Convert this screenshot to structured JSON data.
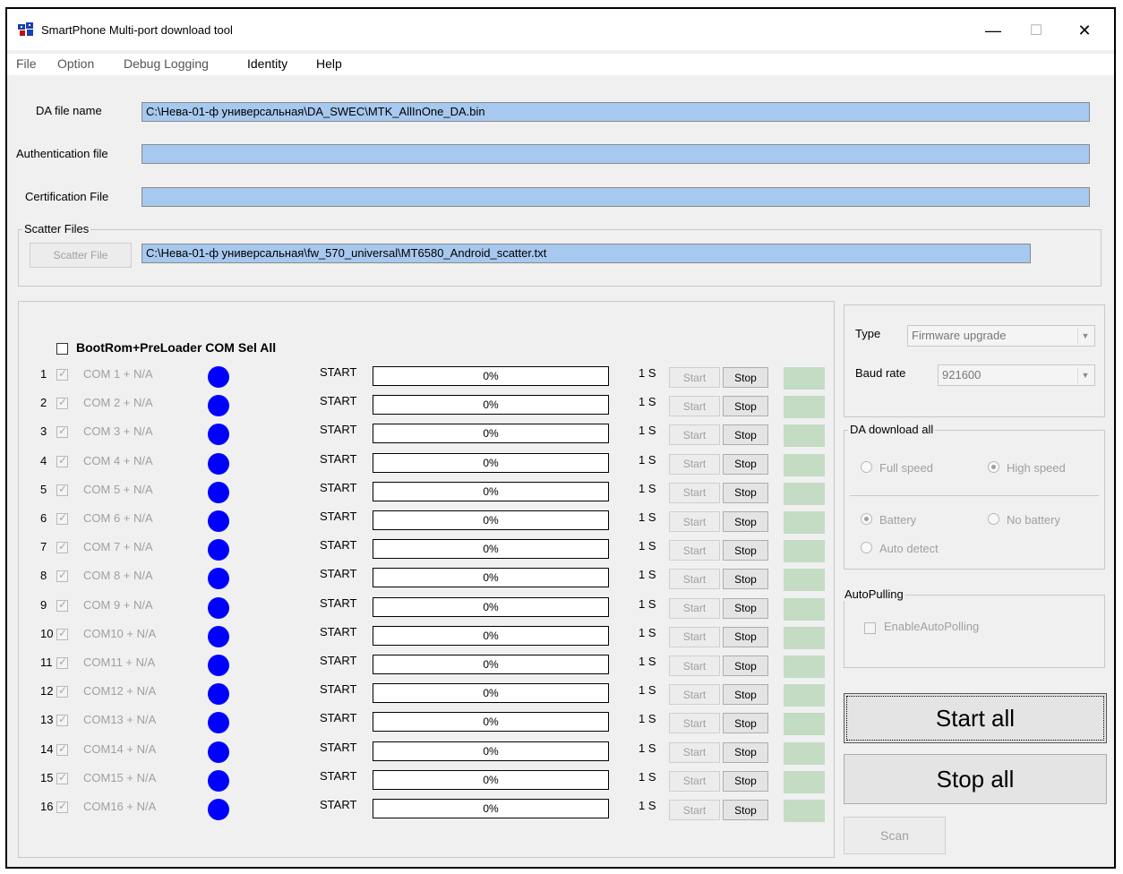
{
  "window": {
    "title": "SmartPhone Multi-port download tool",
    "minimize": "—",
    "maximize": "☐",
    "close": "✕"
  },
  "menu": [
    "File",
    "Option",
    "Debug Logging",
    "Identity",
    "Help"
  ],
  "files": {
    "da_label": "DA file name",
    "da_value": "C:\\Нева-01-ф универсальная\\DA_SWEC\\MTK_AllInOne_DA.bin",
    "auth_label": "Authentication file",
    "auth_value": "",
    "cert_label": "Certification File",
    "cert_value": ""
  },
  "scatter": {
    "group_title": "Scatter Files",
    "button": "Scatter File",
    "value": "C:\\Нева-01-ф универсальная\\fw_570_universal\\MT6580_Android_scatter.txt"
  },
  "ports": {
    "sel_all_label": "BootRom+PreLoader COM Sel All",
    "rows": [
      {
        "num": "1",
        "port": "COM 1 + N/A",
        "status": "START",
        "progress": "0%",
        "time": "1 S",
        "start": "Start",
        "stop": "Stop"
      },
      {
        "num": "2",
        "port": "COM 2 + N/A",
        "status": "START",
        "progress": "0%",
        "time": "1 S",
        "start": "Start",
        "stop": "Stop"
      },
      {
        "num": "3",
        "port": "COM 3 + N/A",
        "status": "START",
        "progress": "0%",
        "time": "1 S",
        "start": "Start",
        "stop": "Stop"
      },
      {
        "num": "4",
        "port": "COM 4 + N/A",
        "status": "START",
        "progress": "0%",
        "time": "1 S",
        "start": "Start",
        "stop": "Stop"
      },
      {
        "num": "5",
        "port": "COM 5 + N/A",
        "status": "START",
        "progress": "0%",
        "time": "1 S",
        "start": "Start",
        "stop": "Stop"
      },
      {
        "num": "6",
        "port": "COM 6 + N/A",
        "status": "START",
        "progress": "0%",
        "time": "1 S",
        "start": "Start",
        "stop": "Stop"
      },
      {
        "num": "7",
        "port": "COM 7 + N/A",
        "status": "START",
        "progress": "0%",
        "time": "1 S",
        "start": "Start",
        "stop": "Stop"
      },
      {
        "num": "8",
        "port": "COM 8 + N/A",
        "status": "START",
        "progress": "0%",
        "time": "1 S",
        "start": "Start",
        "stop": "Stop"
      },
      {
        "num": "9",
        "port": "COM 9 + N/A",
        "status": "START",
        "progress": "0%",
        "time": "1 S",
        "start": "Start",
        "stop": "Stop"
      },
      {
        "num": "10",
        "port": "COM10 + N/A",
        "status": "START",
        "progress": "0%",
        "time": "1 S",
        "start": "Start",
        "stop": "Stop"
      },
      {
        "num": "11",
        "port": "COM11 + N/A",
        "status": "START",
        "progress": "0%",
        "time": "1 S",
        "start": "Start",
        "stop": "Stop"
      },
      {
        "num": "12",
        "port": "COM12 + N/A",
        "status": "START",
        "progress": "0%",
        "time": "1 S",
        "start": "Start",
        "stop": "Stop"
      },
      {
        "num": "13",
        "port": "COM13 + N/A",
        "status": "START",
        "progress": "0%",
        "time": "1 S",
        "start": "Start",
        "stop": "Stop"
      },
      {
        "num": "14",
        "port": "COM14 + N/A",
        "status": "START",
        "progress": "0%",
        "time": "1 S",
        "start": "Start",
        "stop": "Stop"
      },
      {
        "num": "15",
        "port": "COM15 + N/A",
        "status": "START",
        "progress": "0%",
        "time": "1 S",
        "start": "Start",
        "stop": "Stop"
      },
      {
        "num": "16",
        "port": "COM16 + N/A",
        "status": "START",
        "progress": "0%",
        "time": "1 S",
        "start": "Start",
        "stop": "Stop"
      }
    ]
  },
  "settings": {
    "type_label": "Type",
    "type_value": "Firmware upgrade",
    "baud_label": "Baud rate",
    "baud_value": "921600"
  },
  "da_download": {
    "group_title": "DA download all",
    "full_speed": "Full speed",
    "high_speed": "High speed",
    "battery": "Battery",
    "no_battery": "No battery",
    "auto_detect": "Auto detect"
  },
  "autopolling": {
    "group_title": "AutoPulling",
    "enable_label": "EnableAutoPolling"
  },
  "actions": {
    "start_all": "Start all",
    "stop_all": "Stop all",
    "scan": "Scan"
  },
  "colors": {
    "path_field": "#a7c8ef",
    "status_dot": "#0000ff",
    "status_indicator": "#c3dcc3"
  }
}
